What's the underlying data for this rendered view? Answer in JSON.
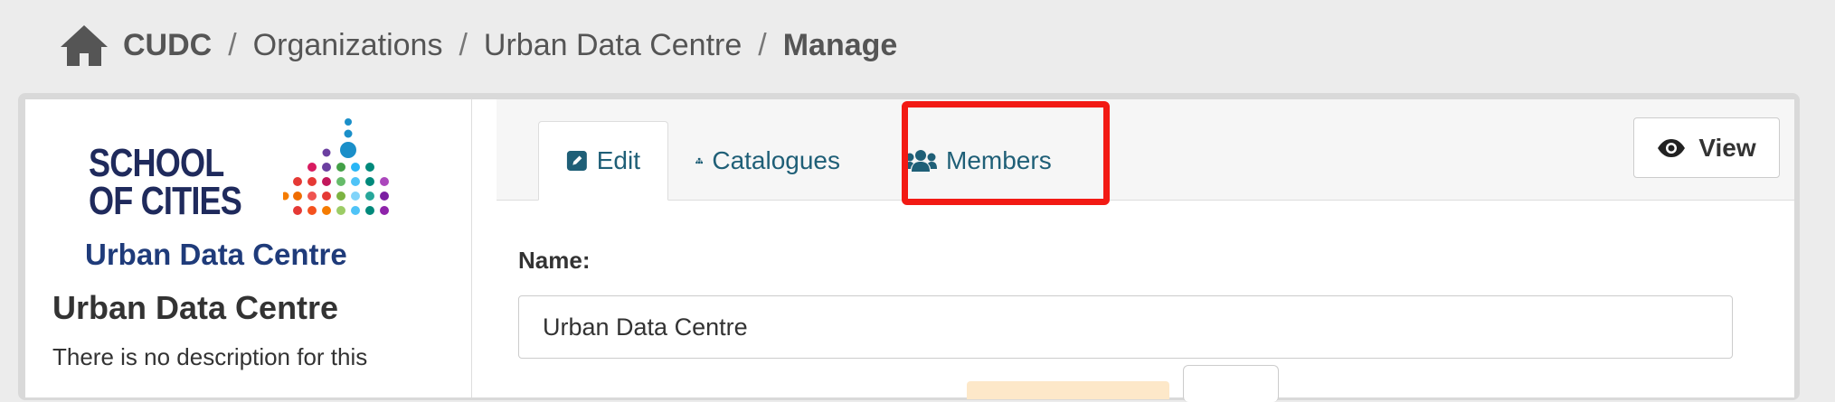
{
  "breadcrumb": {
    "items": [
      "CUDC",
      "Organizations",
      "Urban Data Centre"
    ],
    "active": "Manage",
    "separator": "/"
  },
  "sidebar": {
    "logo": {
      "line1": "SCHOOL",
      "line2": "OF CITIES",
      "line3": "Urban Data Centre"
    },
    "title": "Urban Data Centre",
    "description": "There is no description for this"
  },
  "tabs": [
    {
      "label": "Edit",
      "icon": "edit-icon",
      "active": true
    },
    {
      "label": "Catalogues",
      "icon": "sitemap-icon",
      "active": false
    },
    {
      "label": "Members",
      "icon": "users-icon",
      "active": false
    }
  ],
  "view_button": {
    "label": "View",
    "icon": "eye-icon"
  },
  "form": {
    "name_label": "Name:",
    "name_value": "Urban Data Centre"
  },
  "colors": {
    "link": "#1f5f77",
    "highlight": "#f21a14",
    "logo_navy": "#1f2a5c"
  }
}
